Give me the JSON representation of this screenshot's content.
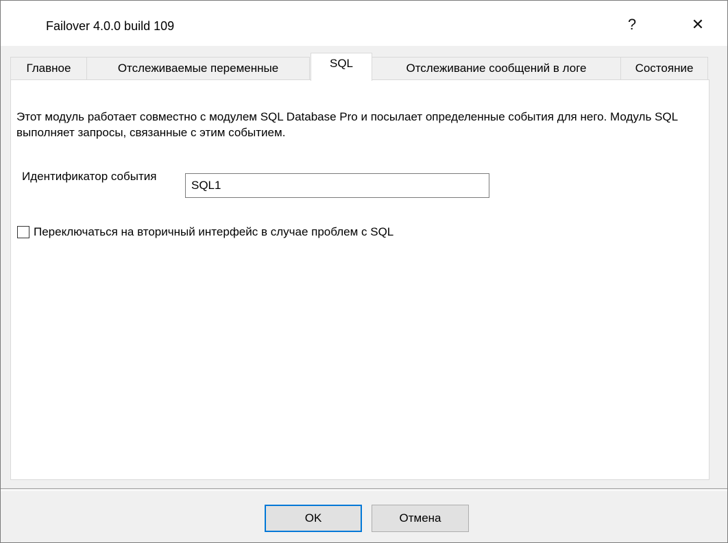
{
  "window": {
    "title": "Failover 4.0.0 build 109",
    "help_label": "?",
    "close_label": "✕"
  },
  "tabs": [
    {
      "label": "Главное",
      "active": false
    },
    {
      "label": "Отслеживаемые переменные",
      "active": false
    },
    {
      "label": "SQL",
      "active": true
    },
    {
      "label": "Отслеживание сообщений в логе",
      "active": false
    },
    {
      "label": "Состояние",
      "active": false
    }
  ],
  "sql_panel": {
    "description": "Этот модуль работает совместно с модулем SQL Database Pro и посылает определенные события для него. Модуль SQL выполняет запросы, связанные с этим событием.",
    "event_id_label": "Идентификатор события",
    "event_id_value": "SQL1",
    "switch_checkbox_label": "Переключаться на вторичный интерфейс в случае проблем с SQL",
    "switch_checkbox_checked": false
  },
  "footer": {
    "ok_label": "OK",
    "cancel_label": "Отмена"
  },
  "colors": {
    "accent": "#0078d7",
    "window_bg": "#f0f0f0"
  }
}
